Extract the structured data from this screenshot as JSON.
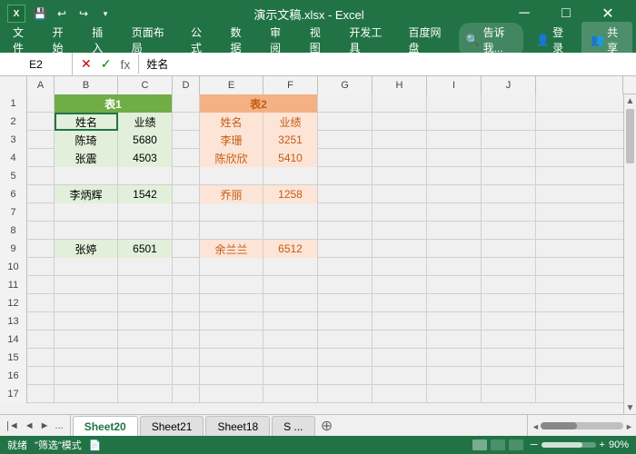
{
  "titlebar": {
    "filename": "演示文稿.xlsx - Excel",
    "min_btn": "─",
    "max_btn": "□",
    "close_btn": "✕"
  },
  "quickaccess": {
    "save": "💾",
    "undo": "↩",
    "redo": "↪",
    "more": "▾"
  },
  "menu": {
    "items": [
      "文件",
      "开始",
      "插入",
      "页面布局",
      "公式",
      "数据",
      "审阅",
      "视图",
      "开发工具",
      "百度网盘"
    ],
    "search": "告诉我...",
    "login": "登录",
    "share": "共享"
  },
  "formulabar": {
    "cell_ref": "E2",
    "formula": "姓名",
    "cancel": "✕",
    "confirm": "✓",
    "fx": "fx"
  },
  "columns": [
    "A",
    "B",
    "C",
    "D",
    "E",
    "F",
    "G",
    "H",
    "I",
    "J"
  ],
  "rows": [
    1,
    2,
    3,
    4,
    5,
    6,
    7,
    8,
    9,
    10,
    11,
    12,
    13,
    14,
    15,
    16,
    17
  ],
  "table1": {
    "header_col1": "表1",
    "col1": "姓名",
    "col2": "业绩",
    "data": [
      {
        "name": "陈琦",
        "value": "5680"
      },
      {
        "name": "张震",
        "value": "4503"
      },
      {
        "name": "李炳辉",
        "value": "1542"
      },
      {
        "name": "张婷",
        "value": "6501"
      }
    ]
  },
  "table2": {
    "header_col1": "表2",
    "col1": "姓名",
    "col2": "业绩",
    "data": [
      {
        "name": "李珊",
        "value": "3251"
      },
      {
        "name": "陈欣欣",
        "value": "5410"
      },
      {
        "name": "乔丽",
        "value": "1258"
      },
      {
        "name": "余兰兰",
        "value": "6512"
      }
    ]
  },
  "sheets": {
    "tabs": [
      "Sheet20",
      "Sheet21",
      "Sheet18",
      "S ..."
    ],
    "active": 0
  },
  "statusbar": {
    "status": "就绪",
    "filter_mode": "\"筛选\"模式",
    "zoom": "90%"
  },
  "colors": {
    "green_header": "#70ad47",
    "light_green": "#e2efda",
    "orange_header": "#f4b183",
    "light_orange": "#fce4d6",
    "excel_green": "#217346",
    "orange_text": "#c55a11"
  }
}
